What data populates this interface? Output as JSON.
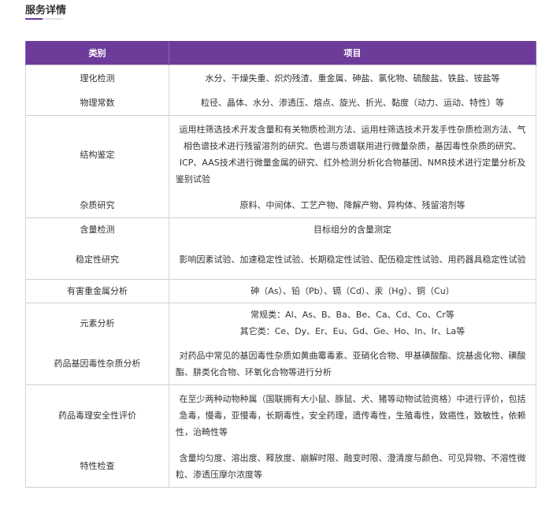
{
  "section": {
    "title": "服务详情"
  },
  "table": {
    "headers": [
      "类别",
      "项目"
    ],
    "rows": [
      {
        "category": "理化检测",
        "items": "水分、干燥失重、炽灼残渣、重金属、砷盐、氯化物、硫酸盐、铁盐、铵盐等"
      },
      {
        "category": "物理常数",
        "items": "粒径、晶体、水分、渗透压、熔点、旋光、折光、黏度（动力、运动、特性）等"
      },
      {
        "category": "结构鉴定",
        "items": "运用柱筛选技术开发含量和有关物质检测方法、运用柱筛选技术开发手性杂质检测方法、气相色谱技术进行残留溶剂的研究、色谱与质谱联用进行微量杂质，基因毒性杂质的研究、ICP、AAS技术进行微量金属的研究、红外检测分析化合物基团、NMR技术进行定量分析及鉴别试验"
      },
      {
        "category": "杂质研究",
        "items": "原料、中间体、工艺产物、降解产物、异构体、残留溶剂等"
      },
      {
        "category": "含量检测",
        "items": "目标组分的含量测定"
      },
      {
        "category": "稳定性研究",
        "items": "影响因素试验、加速稳定性试验、长期稳定性试验、配伍稳定性试验、用药器具稳定性试验"
      },
      {
        "category": "有害重金属分析",
        "items": "砷（As）、铅（Pb）、镉（Cd）、汞（Hg）、铜（Cu）"
      },
      {
        "category": "元素分析",
        "items_line1": "常规类：Al、As、B、Ba、Be、Ca、Cd、Co、Cr等",
        "items_line2": "其它类：Ce、Dy、Er、Eu、Gd、Ge、Ho、In、Ir、La等"
      },
      {
        "category": "药品基因毒性杂质分析",
        "items": "对药品中常见的基因毒性杂质如黄曲霉毒素、亚硝化合物、甲基磺酸酯、烷基卤化物、磺酸酯、肼类化合物、环氧化合物等进行分析"
      },
      {
        "category": "药品毒理安全性评价",
        "items": "在至少两种动物种属（国联拥有大小鼠、豚鼠、犬、猪等动物试验资格）中进行评价，包括急毒，慢毒，亚慢毒，长期毒性，安全药理，遗传毒性，生殖毒性，致癌性，致敏性，依赖性，治畸性等"
      },
      {
        "category": "特性检查",
        "items": "含量均匀度、溶出度、释放度、崩解时限、融变时限、澄清度与颜色、可见异物、不溶性微粒、渗透压摩尔浓度等"
      }
    ]
  },
  "colors": {
    "accent": "#6e3b9b",
    "header_text": "#ffffff",
    "border": "#d6d6d6",
    "text": "#333333"
  }
}
